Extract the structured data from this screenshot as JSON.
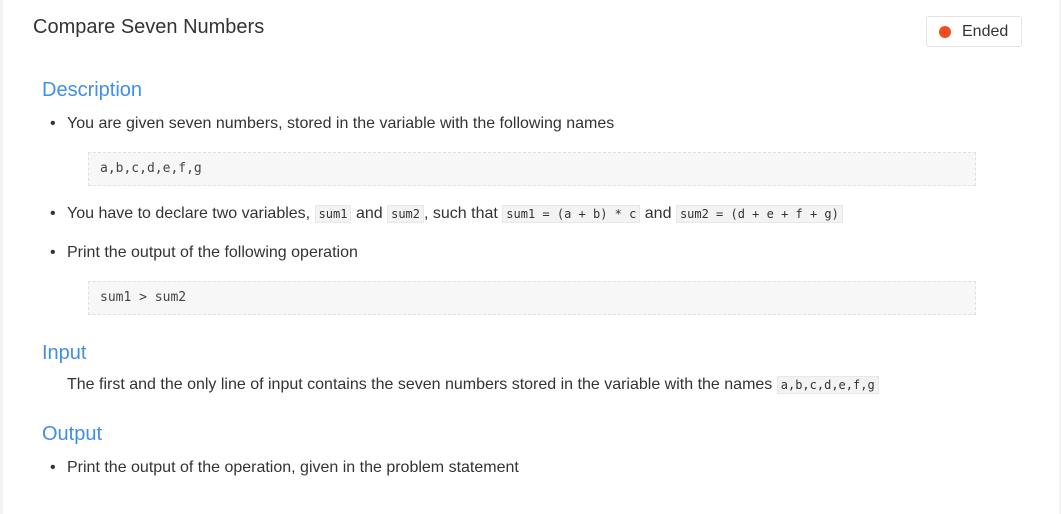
{
  "problem": {
    "title": "Compare Seven Numbers",
    "status": "Ended",
    "status_color": "#f04d22"
  },
  "description": {
    "heading": "Description",
    "bullet1": "You are given seven numbers, stored in the variable with the following names",
    "code1": "a,b,c,d,e,f,g",
    "bullet2_prefix": "You have to declare two variables,",
    "bullet2_code_a": "sum1",
    "bullet2_and1": "and",
    "bullet2_code_b": "sum2",
    "bullet2_such_that": ", such that",
    "bullet2_code_c": "sum1 = (a + b) * c",
    "bullet2_and2": "and",
    "bullet2_code_d": "sum2 = (d + e + f + g)",
    "bullet3": "Print the output of the following operation",
    "code2": "sum1 > sum2"
  },
  "input": {
    "heading": "Input",
    "text": "The first and the only line of input contains the seven numbers stored in the variable with the names",
    "code": "a,b,c,d,e,f,g"
  },
  "output": {
    "heading": "Output",
    "bullet": "Print the output of the operation, given in the problem statement"
  }
}
